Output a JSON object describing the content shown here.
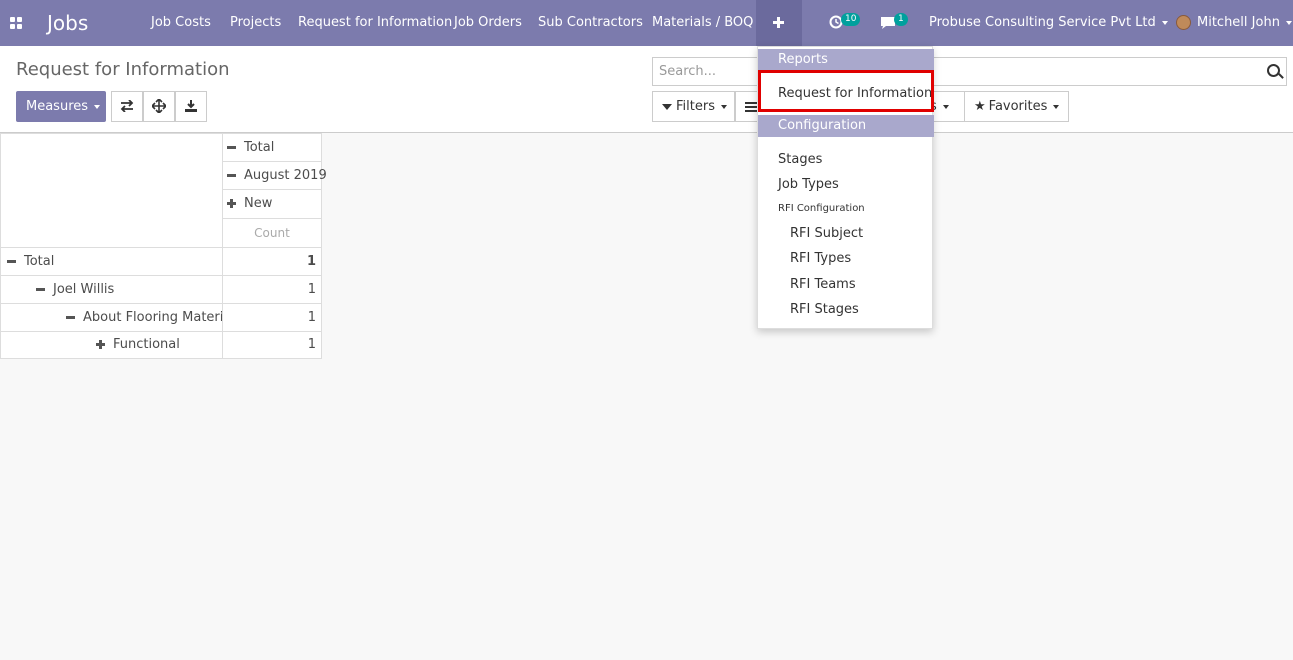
{
  "navbar": {
    "brand": "Jobs",
    "menu": [
      "Job Costs",
      "Projects",
      "Request for Information",
      "Job Orders",
      "Sub Contractors",
      "Materials / BOQ"
    ],
    "activity_count": "10",
    "message_count": "1",
    "company": "Probuse Consulting Service Pvt Ltd",
    "user": "Mitchell John"
  },
  "control_panel": {
    "title": "Request for Information",
    "measures_label": "Measures",
    "search_placeholder": "Search...",
    "filters_label": "Filters",
    "groupby_partial": "s",
    "favorites_label": "Favorites"
  },
  "pivot": {
    "col_headers": [
      "Total",
      "August 2019",
      "New"
    ],
    "measure": "Count",
    "rows": [
      {
        "label": "Total",
        "value": "1"
      },
      {
        "label": "Joel Willis",
        "value": "1"
      },
      {
        "label": "About Flooring Material",
        "value": "1"
      },
      {
        "label": "Functional",
        "value": "1"
      }
    ]
  },
  "dropdown": {
    "reports_header": "Reports",
    "rfi_item": "Request for Information",
    "config_header": "Configuration",
    "stages": "Stages",
    "job_types": "Job Types",
    "rfi_config": "RFI Configuration",
    "rfi_subject": "RFI Subject",
    "rfi_types": "RFI Types",
    "rfi_teams": "RFI Teams",
    "rfi_stages": "RFI Stages"
  }
}
